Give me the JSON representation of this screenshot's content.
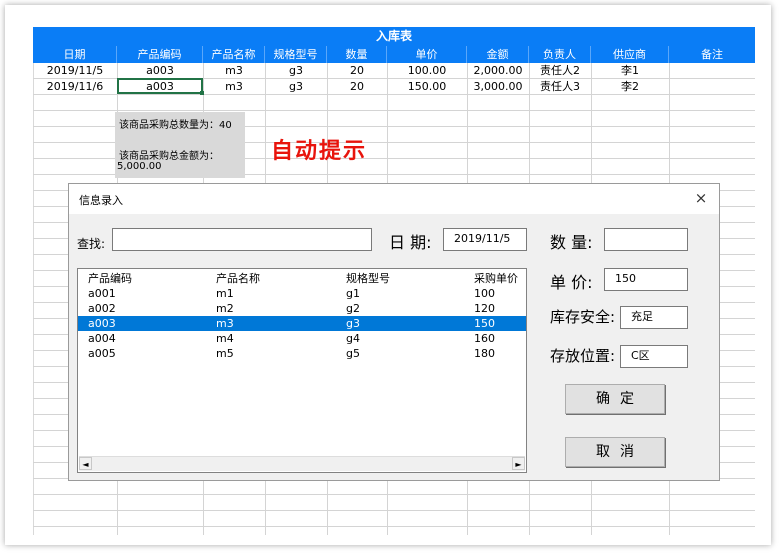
{
  "sheet": {
    "title": "入库表",
    "headers": [
      "日期",
      "产品编码",
      "产品名称",
      "规格型号",
      "数量",
      "单价",
      "金额",
      "负责人",
      "供应商",
      "备注"
    ],
    "rows": [
      [
        "2019/11/5",
        "a003",
        "m3",
        "g3",
        "20",
        "100.00",
        "2,000.00",
        "责任人2",
        "李1",
        ""
      ],
      [
        "2019/11/6",
        "a003",
        "m3",
        "g3",
        "20",
        "150.00",
        "3,000.00",
        "责任人3",
        "李2",
        ""
      ]
    ],
    "tip_qty": "该商品采购总数量为：40",
    "tip_amt_label": "该商品采购总金额为：",
    "tip_amt_value": "5,000.00",
    "auto_hint": "自动提示"
  },
  "dialog": {
    "title": "信息录入",
    "close": "×",
    "search_label": "查找:",
    "search_value": "",
    "date_label": "日 期:",
    "date_value": "2019/11/5",
    "qty_label": "数 量:",
    "qty_value": "",
    "price_label": "单 价:",
    "price_value": "150",
    "stock_label": "库存安全:",
    "stock_value": "充足",
    "location_label": "存放位置:",
    "location_value": "C区",
    "ok_label": "确定",
    "cancel_label": "取消",
    "list_headers": [
      "产品编码",
      "产品名称",
      "规格型号",
      "采购单价"
    ],
    "list_rows": [
      [
        "a001",
        "m1",
        "g1",
        "100"
      ],
      [
        "a002",
        "m2",
        "g2",
        "120"
      ],
      [
        "a003",
        "m3",
        "g3",
        "150"
      ],
      [
        "a004",
        "m4",
        "g4",
        "160"
      ],
      [
        "a005",
        "m5",
        "g5",
        "180"
      ]
    ],
    "selected_row": 2,
    "scroll_left": "◄",
    "scroll_right": "►"
  }
}
